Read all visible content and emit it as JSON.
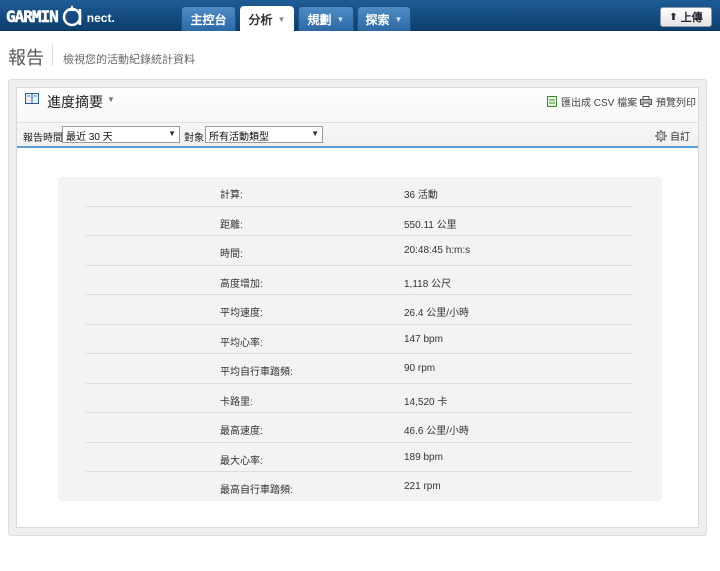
{
  "app": {
    "logo_main": "GARMIN",
    "logo_suffix": "nect."
  },
  "nav": {
    "tabs": [
      {
        "label": "主控台",
        "active": false,
        "has_menu": false
      },
      {
        "label": "分析",
        "active": true,
        "has_menu": true
      },
      {
        "label": "規劃",
        "active": false,
        "has_menu": true
      },
      {
        "label": "探索",
        "active": false,
        "has_menu": true
      }
    ],
    "upload_label": "上傳"
  },
  "page": {
    "title": "報告",
    "subtitle": "檢視您的活動紀錄統計資料"
  },
  "panel": {
    "title": "進度摘要",
    "export_csv": "匯出成 CSV 檔案",
    "print_preview": "預覽列印",
    "customize": "自訂"
  },
  "filters": {
    "period_label": "報告時間",
    "period_value": "最近 30 天",
    "target_label": "對象",
    "target_value": "所有活動類型"
  },
  "stats": [
    {
      "label": "計算:",
      "value": "36 活動"
    },
    {
      "label": "距離:",
      "value": "550.11 公里"
    },
    {
      "label": "時間:",
      "value": "20:48:45 h:m:s"
    },
    {
      "label": "高度增加:",
      "value": "1,118 公尺"
    },
    {
      "label": "平均速度:",
      "value": "26.4 公里/小時"
    },
    {
      "label": "平均心率:",
      "value": "147 bpm"
    },
    {
      "label": "平均自行車踏頻:",
      "value": "90 rpm"
    },
    {
      "label": "卡路里:",
      "value": "14,520 卡"
    },
    {
      "label": "最高速度:",
      "value": "46.6 公里/小時"
    },
    {
      "label": "最大心率:",
      "value": "189 bpm"
    },
    {
      "label": "最高自行車踏頻:",
      "value": "221 rpm"
    }
  ],
  "colors": {
    "nav_bar": "#0d3e6e",
    "accent_line": "#5aa0d6",
    "stats_bg": "#f3f3f3"
  },
  "icons": {
    "panel": "book-icon",
    "export": "spreadsheet-icon",
    "print": "printer-icon",
    "customize": "gear-icon",
    "upload": "arrow-up-icon"
  }
}
